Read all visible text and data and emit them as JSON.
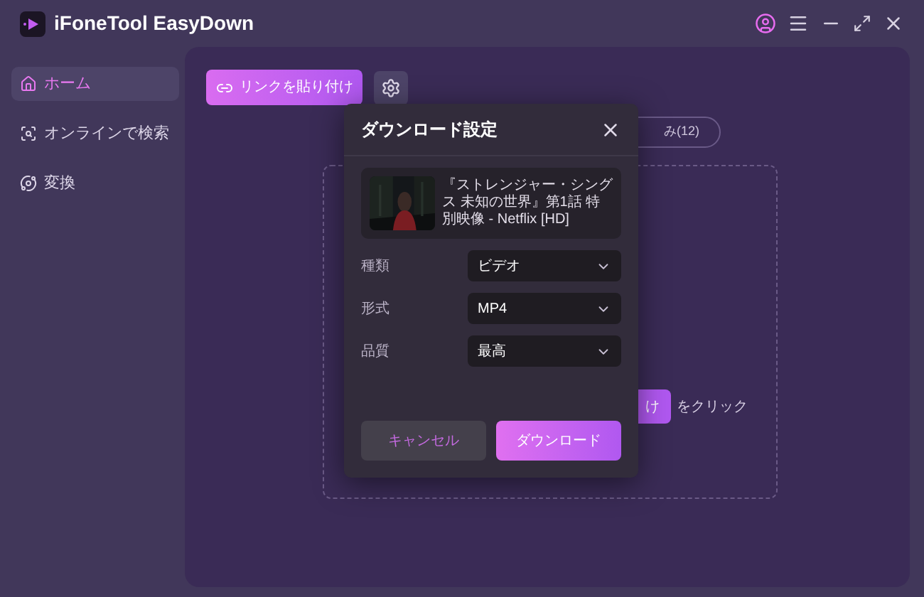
{
  "app": {
    "title": "iFoneTool EasyDown"
  },
  "sidebar": {
    "items": [
      {
        "label": "ホーム",
        "selected": true
      },
      {
        "label": "オンラインで検索",
        "selected": false
      },
      {
        "label": "変換",
        "selected": false
      }
    ]
  },
  "toolbar": {
    "paste_button": "リンクを貼り付け"
  },
  "tab_pill": "み(12)",
  "hint": {
    "button": "け",
    "text": "をクリック"
  },
  "dialog": {
    "title": "ダウンロード設定",
    "video": {
      "kind": "picture",
      "title": "『ストレンジャー・シングス 未知の世界』第1話 特別映像 - Netflix [HD]"
    },
    "settings": [
      {
        "label": "種類",
        "value": "ビデオ"
      },
      {
        "label": "形式",
        "value": "MP4"
      },
      {
        "label": "品質",
        "value": "最高"
      }
    ],
    "buttons": {
      "cancel": "キャンセル",
      "confirm": "ダウンロード"
    }
  }
}
